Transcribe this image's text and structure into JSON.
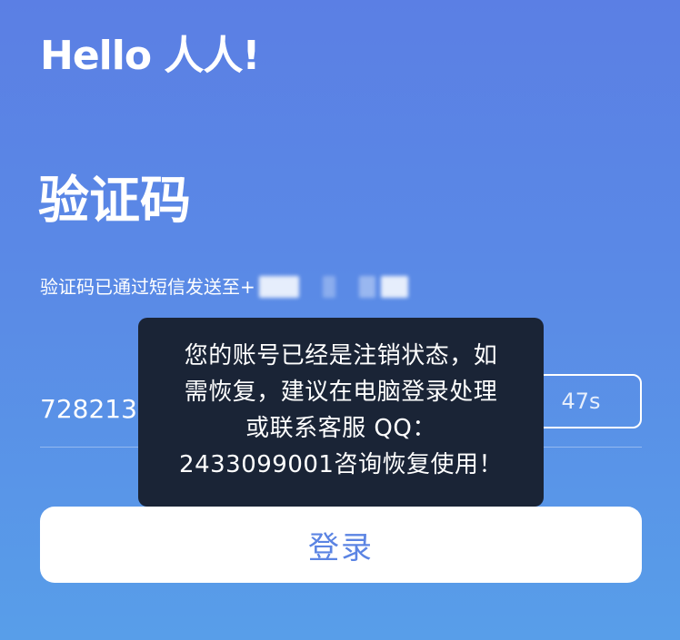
{
  "app": {
    "logo_text": "Hello 人人!"
  },
  "page": {
    "title": "验证码",
    "sms_hint": "验证码已通过短信发送至+"
  },
  "form": {
    "code_value": "728213",
    "countdown_label": "47s",
    "login_label": "登录"
  },
  "toast": {
    "lines": [
      "您的账号已经是注销状态，如",
      "需恢复，建议在电脑登录处理",
      "或联系客服 QQ：",
      "2433099001咨询恢复使用！"
    ]
  },
  "colors": {
    "background_top": "#5b7fe4",
    "background_bottom": "#589ee9",
    "toast_background": "#1a2436",
    "button_text": "#5b84e3"
  }
}
